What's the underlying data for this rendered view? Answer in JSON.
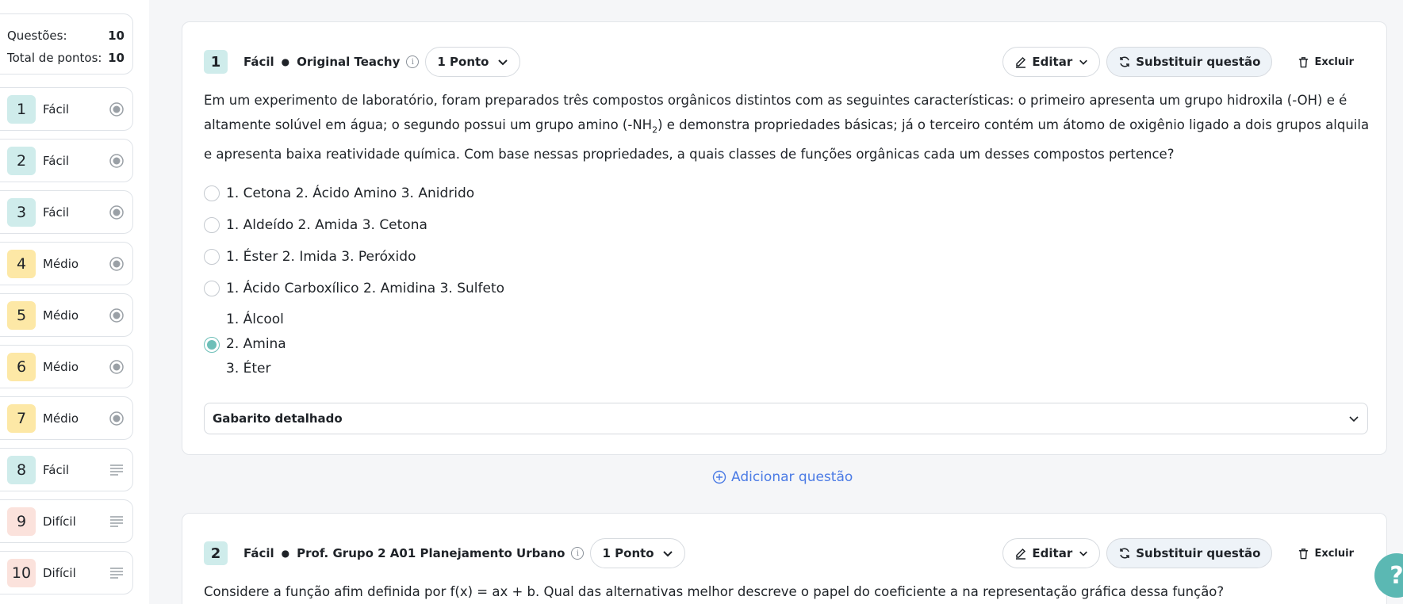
{
  "summary": {
    "questions_label": "Questões:",
    "questions_value": "10",
    "points_label": "Total de pontos:",
    "points_value": "10"
  },
  "nav": [
    {
      "num": "1",
      "level": "Fácil",
      "kind": "easy",
      "icon": "radio-icon"
    },
    {
      "num": "2",
      "level": "Fácil",
      "kind": "easy",
      "icon": "radio-icon"
    },
    {
      "num": "3",
      "level": "Fácil",
      "kind": "easy",
      "icon": "radio-icon"
    },
    {
      "num": "4",
      "level": "Médio",
      "kind": "med",
      "icon": "radio-icon"
    },
    {
      "num": "5",
      "level": "Médio",
      "kind": "med",
      "icon": "radio-icon"
    },
    {
      "num": "6",
      "level": "Médio",
      "kind": "med",
      "icon": "radio-icon"
    },
    {
      "num": "7",
      "level": "Médio",
      "kind": "med",
      "icon": "radio-icon"
    },
    {
      "num": "8",
      "level": "Fácil",
      "kind": "easy",
      "icon": "text-lines-icon"
    },
    {
      "num": "9",
      "level": "Difícil",
      "kind": "hard",
      "icon": "text-lines-icon"
    },
    {
      "num": "10",
      "level": "Difícil",
      "kind": "hard",
      "icon": "text-lines-icon"
    }
  ],
  "q1": {
    "num": "1",
    "level": "Fácil",
    "source": "Original Teachy",
    "points": "1 Ponto",
    "edit": "Editar",
    "replace": "Substituir questão",
    "delete": "Excluir",
    "text_a": "Em um experimento de laboratório, foram preparados três compostos orgânicos distintos com as seguintes características: o primeiro apresenta um grupo hidroxila (-OH) e é altamente solúvel em água; o segundo possui um grupo amino (-NH",
    "text_sub": "2",
    "text_b": ") e demonstra propriedades básicas; já o terceiro contém um átomo de oxigênio ligado a dois grupos alquila e apresenta baixa reatividade química. Com base nessas propriedades, a quais classes de funções orgânicas cada um desses compostos pertence?",
    "options": [
      "1. Cetona 2. Ácido Amino 3. Anidrido",
      "1. Aldeído 2. Amida 3. Cetona",
      "1. Éster 2. Imida 3. Peróxido",
      "1. Ácido Carboxílico 2. Amidina 3. Sulfeto"
    ],
    "selected_lines": [
      "1. Álcool",
      "2. Amina",
      "3. Éter"
    ],
    "gabarito": "Gabarito detalhado"
  },
  "add_question": "Adicionar questão",
  "q2": {
    "num": "2",
    "level": "Fácil",
    "source": "Prof. Grupo 2 A01 Planejamento Urbano",
    "points": "1 Ponto",
    "edit": "Editar",
    "replace": "Substituir questão",
    "delete": "Excluir",
    "text": "Considere a função afim definida por f(x) = ax + b. Qual das alternativas melhor descreve o papel do coeficiente a na representação gráfica dessa função?"
  },
  "help": "?",
  "colors": {
    "accent": "#6dbfb8",
    "easy": "#cfeceb",
    "medium": "#fde8a6",
    "hard": "#fbe2dc",
    "link": "#4b7be5"
  }
}
